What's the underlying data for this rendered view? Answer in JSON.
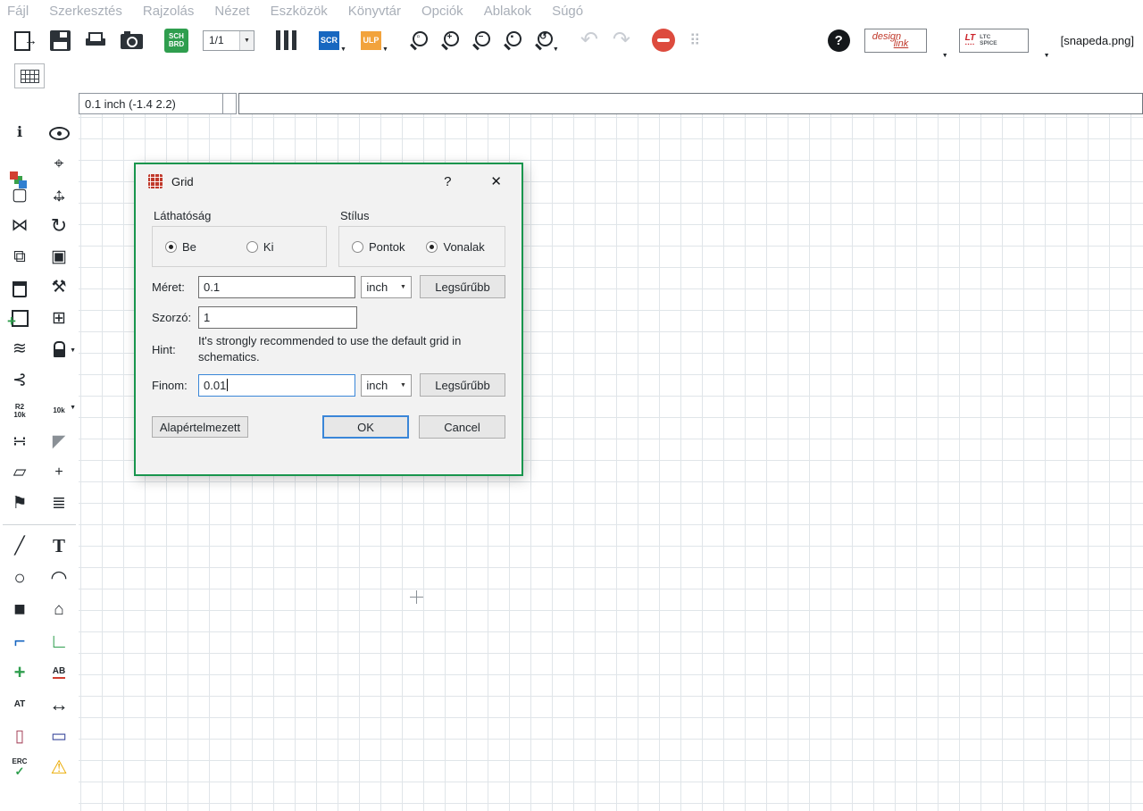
{
  "menu": {
    "items": [
      "Fájl",
      "Szerkesztés",
      "Rajzolás",
      "Nézet",
      "Eszközök",
      "Könyvtár",
      "Opciók",
      "Ablakok",
      "Súgó"
    ]
  },
  "toolbar": {
    "sheet": "1/1",
    "sch": "SCH",
    "brd": "BRD",
    "scr": "SCR",
    "ulp": "ULP",
    "design_link_top": "design",
    "design_link_bottom": "link",
    "ltc_line1": "LTC",
    "ltc_line2": "SPICE",
    "ltc_logo": "LT",
    "ltc_dots": "▪▪▪▪",
    "filename": "[snapeda.png]"
  },
  "statusbar": {
    "coordinates": "0.1 inch (-1.4 2.2)",
    "command": ""
  },
  "icons": {
    "info": "ℹ",
    "mark": "⌖",
    "group": "▢",
    "mirror": "⋈",
    "rotate": "↻",
    "copy": "⧉",
    "paste": "▣",
    "change": "⚒",
    "invoke": "⊞",
    "netclass": "≋",
    "gateswap": "⊰",
    "name_top": "R2",
    "name_bottom": "10k",
    "value_label": "10k",
    "smash": "∺",
    "miter": "◤",
    "split": "▱",
    "junction_small": "+",
    "labelflag": "⚑",
    "attrlist": "≣",
    "wire": "╱",
    "text": "T",
    "circle": "○",
    "arc": "◠",
    "rect": "■",
    "polygon": "⌂",
    "bus": "⌐",
    "net": "∟",
    "junction": "+",
    "label_ab": "AB",
    "attr_at": "AT",
    "dimension": "↔",
    "port": "▯",
    "frame": "▭",
    "erc": "ERC",
    "erc_check": "✓",
    "warning": "⚠",
    "undo": "↶",
    "redo": "↷",
    "dots": "⠿",
    "help": "?",
    "dd": "▼",
    "zoom_fit": "▫",
    "zoom_in": "+",
    "zoom_out": "−",
    "zoom_select": "▪",
    "zoom_redraw": "↺"
  },
  "dialog": {
    "title": "Grid",
    "help_button": "?",
    "close_button": "✕",
    "visibility": {
      "label": "Láthatóság",
      "options": [
        {
          "label": "Be",
          "selected": true
        },
        {
          "label": "Ki",
          "selected": false
        }
      ]
    },
    "style": {
      "label": "Stílus",
      "options": [
        {
          "label": "Pontok",
          "selected": false
        },
        {
          "label": "Vonalak",
          "selected": true
        }
      ]
    },
    "rows": {
      "size": {
        "label": "Méret:",
        "value": "0.1",
        "unit": "inch",
        "button": "Legsűrűbb"
      },
      "multiple": {
        "label": "Szorzó:",
        "value": "1"
      },
      "hint": {
        "label": "Hint:",
        "text": "It's strongly recommended to use the default grid in schematics."
      },
      "alt": {
        "label": "Finom:",
        "value": "0.01",
        "unit": "inch",
        "button": "Legsűrűbb"
      }
    },
    "buttons": {
      "default": "Alapértelmezett",
      "ok": "OK",
      "cancel": "Cancel"
    }
  },
  "colors": {
    "accent_green": "#18954d",
    "focus_blue": "#3a86d8",
    "stop_red": "#dd4b3e",
    "scr_blue": "#1767c0",
    "ulp_orange": "#f2a33c",
    "sch_green": "#2f9e4e",
    "warning_yellow": "#eaaa00",
    "logo_red": "#cc2229"
  }
}
